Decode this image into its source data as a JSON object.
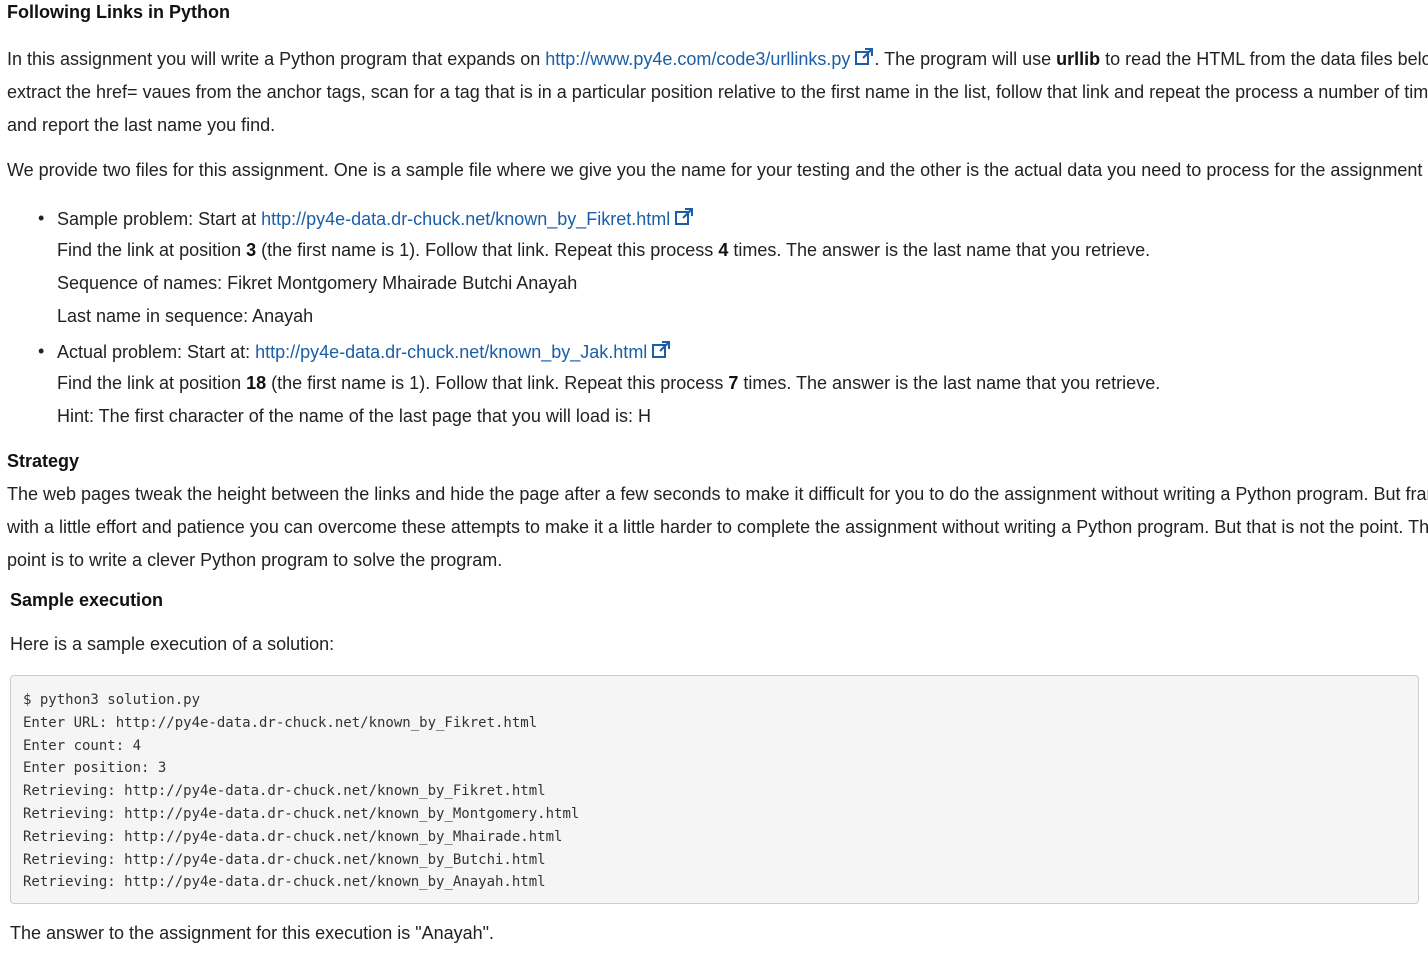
{
  "title": "Following Links in Python",
  "intro": {
    "before_link": "In this assignment you will write a Python program that expands on ",
    "link": "http://www.py4e.com/code3/urllinks.py",
    "mid1": ". The program will use ",
    "bold": "urllib",
    "after_bold_line1": " to read the HTML from the data files below,",
    "line2": "extract the href= vaues from the anchor tags, scan for a tag that is in a particular position relative to the first name in the list, follow that link and repeat the process a number of times",
    "line3": "and report the last name you find."
  },
  "files_para": "We provide two files for this assignment. One is a sample file where we give you the name for your testing and the other is the actual data you need to process for the assignment",
  "sample_problem": {
    "label": "Sample problem: Start at ",
    "link": "http://py4e-data.dr-chuck.net/known_by_Fikret.html",
    "find_pre": "Find the link at position ",
    "position": "3",
    "find_mid": " (the first name is 1). Follow that link. Repeat this process ",
    "count": "4",
    "find_post": " times. The answer is the last name that you retrieve.",
    "sequence": "Sequence of names: Fikret Montgomery Mhairade Butchi Anayah",
    "last_name": "Last name in sequence: Anayah"
  },
  "actual_problem": {
    "label": "Actual problem: Start at: ",
    "link": "http://py4e-data.dr-chuck.net/known_by_Jak.html",
    "find_pre": "Find the link at position ",
    "position": "18",
    "find_mid": " (the first name is 1). Follow that link. Repeat this process ",
    "count": "7",
    "find_post": " times. The answer is the last name that you retrieve.",
    "hint": "Hint: The first character of the name of the last page that you will load is: H"
  },
  "strategy": {
    "heading": "Strategy",
    "line1": "The web pages tweak the height between the links and hide the page after a few seconds to make it difficult for you to do the assignment without writing a Python program. But frankly",
    "line2": "with a little effort and patience you can overcome these attempts to make it a little harder to complete the assignment without writing a Python program. But that is not the point. The",
    "line3": "point is to write a clever Python program to solve the program."
  },
  "sample_execution": {
    "heading": "Sample execution",
    "intro": "Here is a sample execution of a solution:",
    "code_lines": [
      "$ python3 solution.py",
      "Enter URL: http://py4e-data.dr-chuck.net/known_by_Fikret.html",
      "Enter count: 4",
      "Enter position: 3",
      "Retrieving: http://py4e-data.dr-chuck.net/known_by_Fikret.html",
      "Retrieving: http://py4e-data.dr-chuck.net/known_by_Montgomery.html",
      "Retrieving: http://py4e-data.dr-chuck.net/known_by_Mhairade.html",
      "Retrieving: http://py4e-data.dr-chuck.net/known_by_Butchi.html",
      "Retrieving: http://py4e-data.dr-chuck.net/known_by_Anayah.html"
    ],
    "answer": "The answer to the assignment for this execution is \"Anayah\"."
  },
  "colors": {
    "link": "#1a5ea8",
    "text": "#222222",
    "code_bg": "#f5f5f5",
    "code_border": "#cccccc"
  },
  "icons": {
    "external": "external-link-icon",
    "bullet": "bullet-dot"
  }
}
